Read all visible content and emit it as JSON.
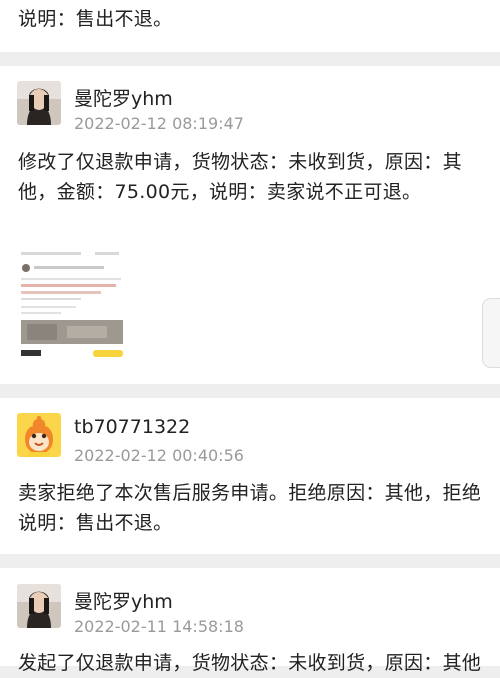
{
  "entries": [
    {
      "message": "说明：售出不退。"
    },
    {
      "user": "曼陀罗yhm",
      "avatar_icon": "user-photo-avatar",
      "time": "2022-02-12 08:19:47",
      "message": "修改了仅退款申请，货物状态：未收到货，原因：其他，金额：75.00元，说明：卖家说不正可退。",
      "attachment": "screenshot-thumbnail"
    },
    {
      "user": "tb70771322",
      "avatar_icon": "orange-mascot-avatar",
      "time": "2022-02-12 00:40:56",
      "message": "卖家拒绝了本次售后服务申请。拒绝原因：其他，拒绝说明：售出不退。"
    },
    {
      "user": "曼陀罗yhm",
      "avatar_icon": "user-photo-avatar",
      "time": "2022-02-11 14:58:18",
      "message": "发起了仅退款申请，货物状态：未收到货，原因：其他"
    }
  ],
  "colors": {
    "page_background": "#eeeeee",
    "card_background": "#ffffff",
    "timestamp": "#9a9a9a",
    "mascot_orange": "#f2862a",
    "mascot_yellow": "#f7d43c"
  }
}
